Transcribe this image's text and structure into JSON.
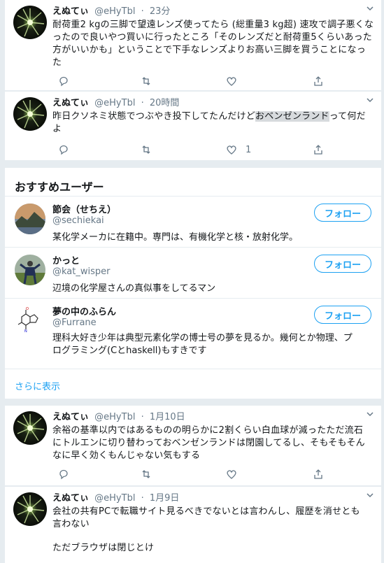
{
  "tweets_top": [
    {
      "name": "えぬてぃ",
      "handle": "@eHyTbl",
      "time": "23分",
      "text": "耐荷重2 kgの三脚で望遠レンズ使ってたら (総重量3 kg超) 速攻で調子悪くなったので良いやつ買いに行ったところ「そのレンズだと耐荷重5くらいあった方がいいかも」ということで下手なレンズよりお高い三脚を買うことになった",
      "likes": ""
    },
    {
      "name": "えぬてぃ",
      "handle": "@eHyTbl",
      "time": "20時間",
      "text_before": "昨日クソネミ状態でつぶやき投下してたんだけど",
      "text_highlight": "おベンゼンランド",
      "text_after": "って何だよ",
      "likes": "1"
    }
  ],
  "recommend": {
    "title": "おすすめユーザー",
    "users": [
      {
        "name": "節会（せちえ）",
        "handle": "@sechiekai",
        "bio": "某化学メーカに在籍中。専門は、有機化学と核・放射化学。",
        "follow": "フォロー"
      },
      {
        "name": "かっと",
        "handle": "@kat_wisper",
        "bio": "辺境の化学屋さんの真似事をしてるマン",
        "follow": "フォロー"
      },
      {
        "name": "夢の中のふらん",
        "handle": "@Furrane",
        "bio": "理科大好き少年は典型元素化学の博士号の夢を見るか。幾何とか物理、プログラミング(Cとhaskell)もすきです",
        "follow": "フォロー"
      }
    ],
    "more": "さらに表示"
  },
  "tweets_bottom": [
    {
      "name": "えぬてぃ",
      "handle": "@eHyTbl",
      "time": "1月10日",
      "text": "余裕の基準以内ではあるものの明らかに2割くらい白血球が減ったただ流石にトルエンに切り替わっておベンゼンランドは閉園してるし、そもそもそんなに早く効くもんじゃない気もする",
      "likes": ""
    },
    {
      "name": "えぬてぃ",
      "handle": "@eHyTbl",
      "time": "1月9日",
      "text": "会社の共有PCで転職サイト見るべきでないとは言わんし、履歴を消せとも言わない",
      "text2": "ただブラウザは閉じとけ"
    }
  ],
  "icons": [
    "chevron-down-icon",
    "reply-icon",
    "retweet-icon",
    "like-icon",
    "share-icon"
  ]
}
